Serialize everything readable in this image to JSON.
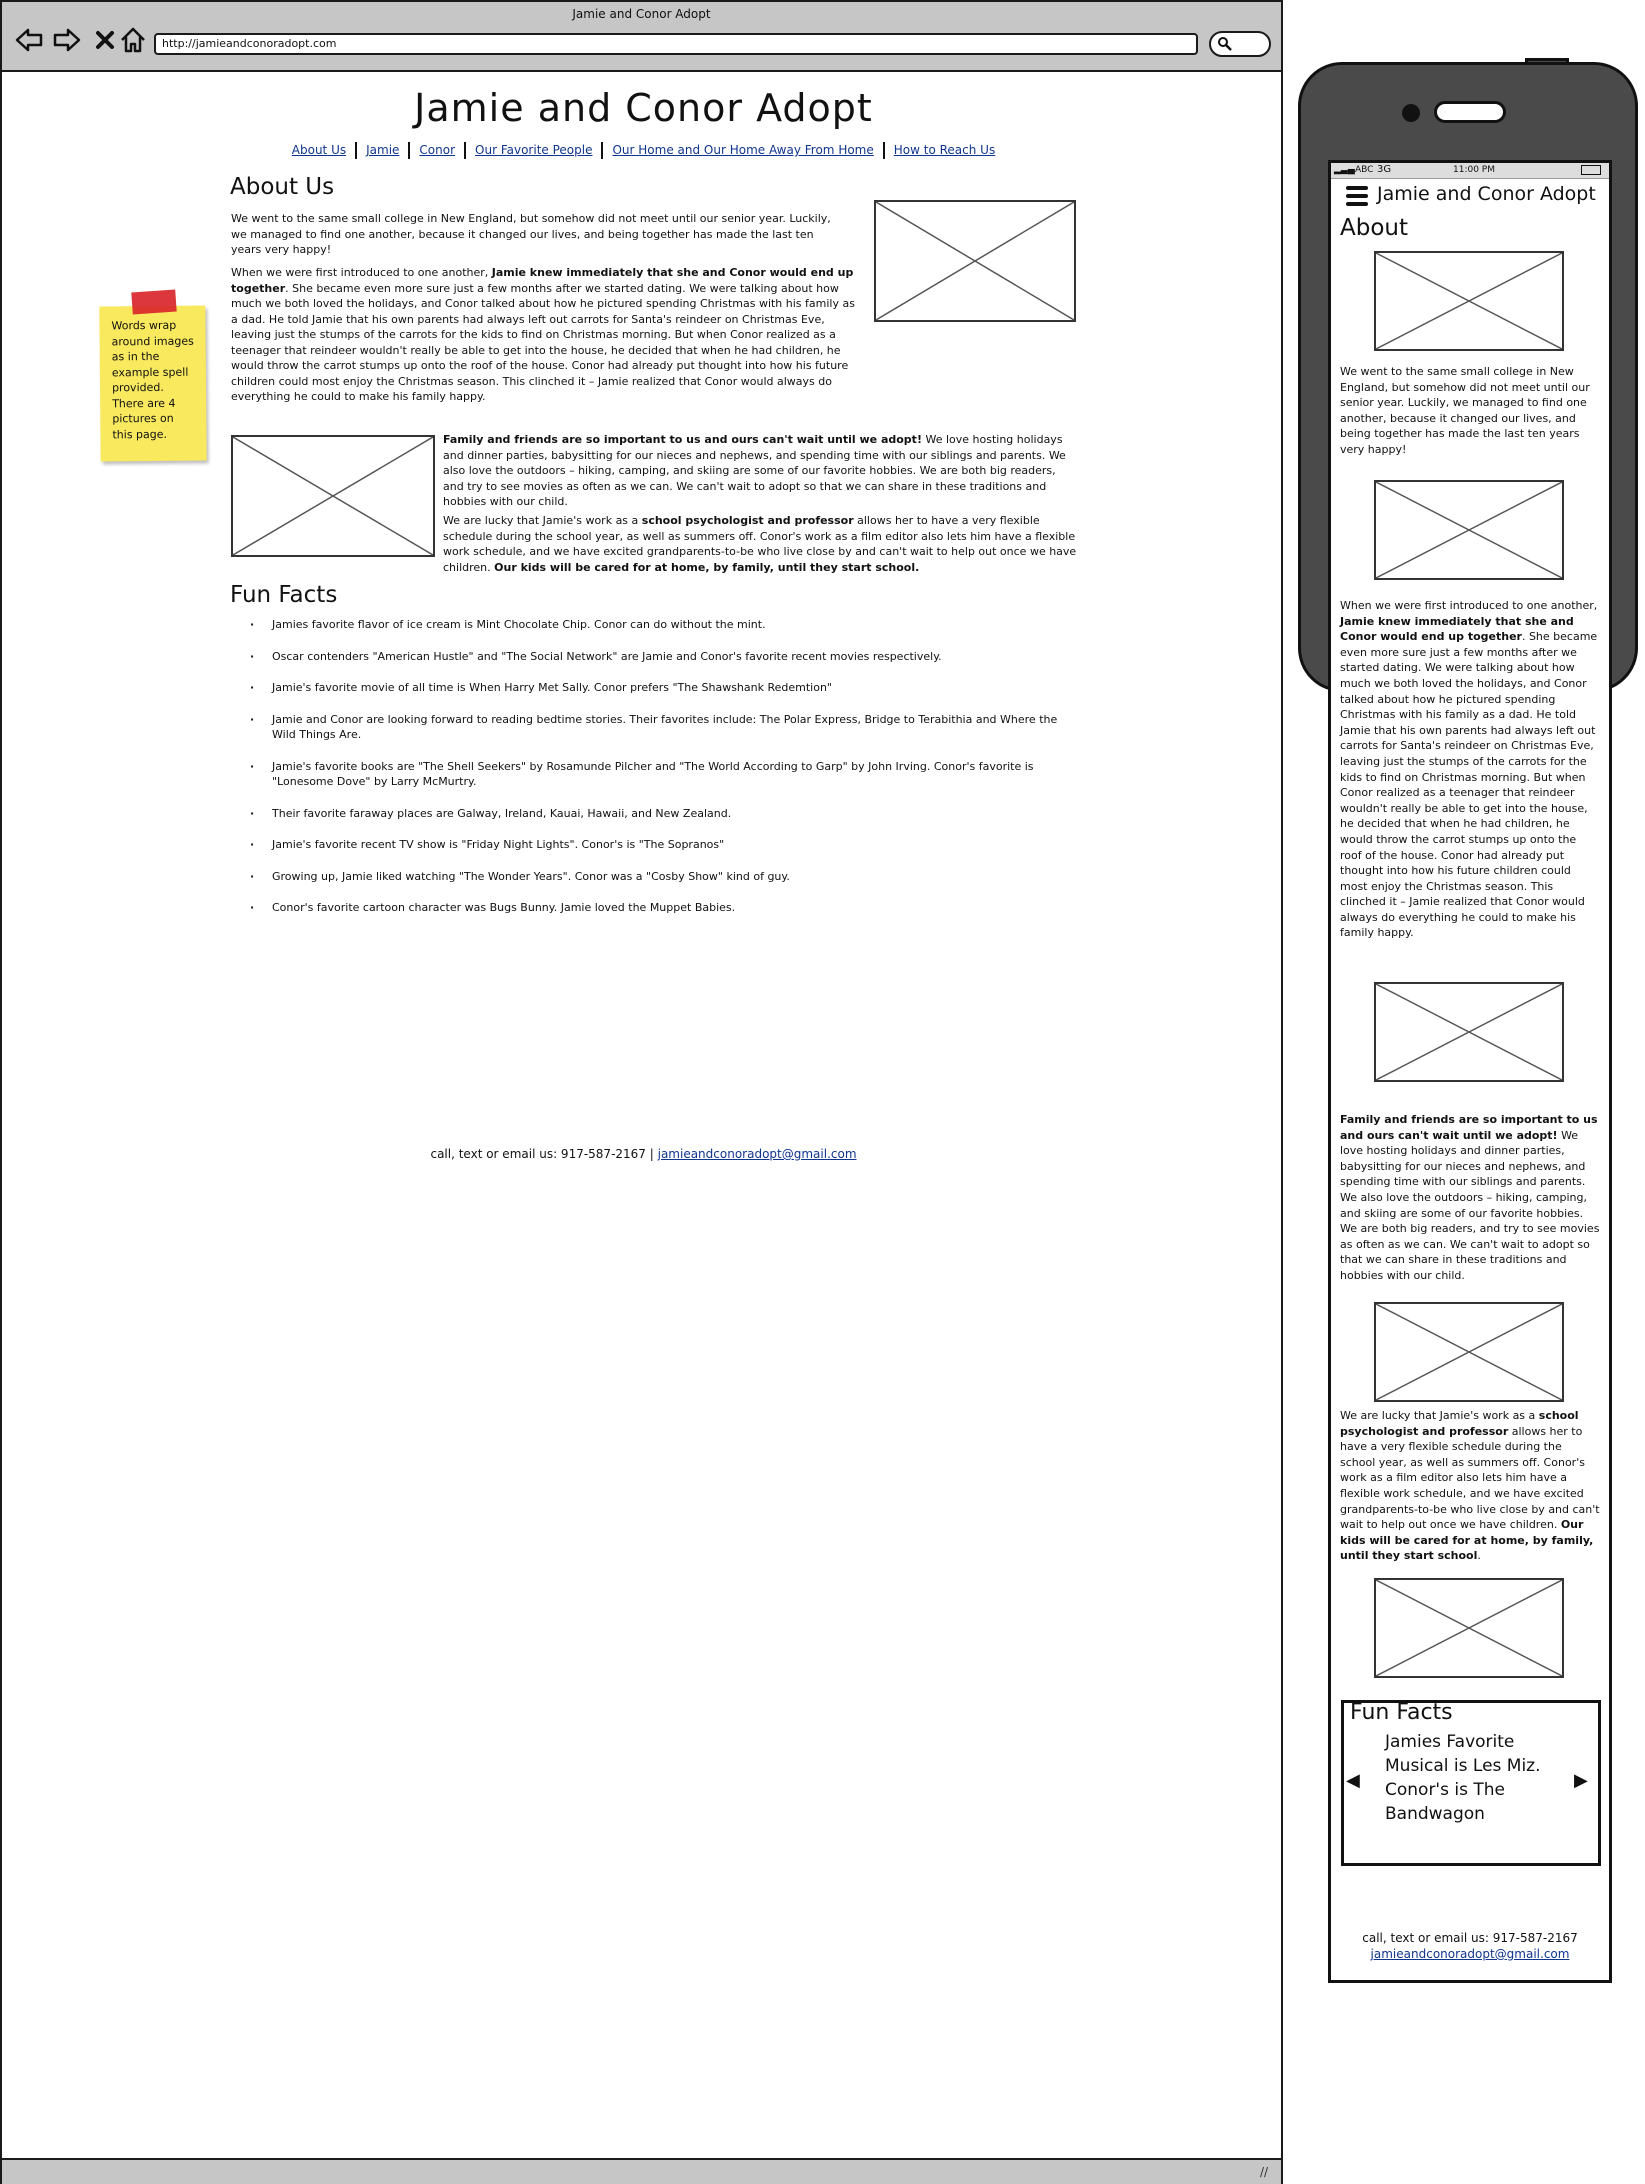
{
  "browser": {
    "window_title": "Jamie and Conor Adopt",
    "url": "http://jamieandconoradopt.com"
  },
  "desktop": {
    "site_title": "Jamie and Conor Adopt",
    "nav": [
      "About Us",
      "Jamie",
      "Conor",
      "Our Favorite People",
      "Our Home and Our Home Away From Home",
      "How to Reach Us"
    ],
    "about_heading": "About Us",
    "about_p1": "We went to the same small college in New England, but somehow did not meet until our senior year. Luckily, we managed to find one another, because it changed our lives, and being together has made the last ten years very happy!",
    "about_p2_pre": "When we were first introduced to one another, ",
    "about_p2_bold": "Jamie knew immediately that she and Conor would end up together",
    "about_p2_post": ". She became even more sure just a few months after we started dating. We were talking about how much we both loved the holidays, and Conor talked about how he pictured spending Christmas with his family as a dad. He told Jamie that his own parents had always left out carrots for Santa's reindeer on Christmas Eve, leaving just the stumps of the carrots for the kids to find on Christmas morning. But when Conor realized as a teenager that reindeer wouldn't really be able to get into the house, he decided that when he had children, he would throw the carrot stumps up onto the roof of the house. Conor had already put thought into how his future children could most enjoy the Christmas season. This clinched it – Jamie realized that Conor would always do everything he could to make his family happy.",
    "family_bold": "Family and friends are so important to us and ours can't wait until we adopt!",
    "family_post": " We love hosting holidays and dinner parties, babysitting for our nieces and nephews, and spending time with our siblings and parents. We also love the outdoors – hiking, camping, and skiing are some of our favorite hobbies. We are both big readers, and try to see movies as often as we can. We can't wait to adopt so that we can share in these traditions and hobbies with our child.",
    "work_pre": "We are lucky that Jamie's work as a ",
    "work_bold1": "school psychologist and professor",
    "work_mid": " allows her to have a very flexible schedule during the school year, as well as summers off. Conor's work as a film editor also lets him have a flexible work schedule, and we have excited grandparents-to-be who live close by and can't wait to help out once we have children. ",
    "work_bold2": "Our kids will be cared for at home, by family, until they start school.",
    "fun_heading": "Fun Facts",
    "fun_facts": [
      "Jamies favorite flavor of ice cream is Mint Chocolate Chip. Conor can do without the mint.",
      "Oscar contenders \"American Hustle\" and \"The Social Network\" are Jamie and Conor's favorite recent movies respectively.",
      "Jamie's favorite movie of all time is When Harry Met Sally. Conor prefers \"The Shawshank Redemtion\"",
      "Jamie and Conor are looking forward to reading bedtime stories. Their favorites include: The Polar Express, Bridge to Terabithia and Where the Wild Things Are.",
      "Jamie's favorite books are \"The Shell Seekers\" by Rosamunde Pilcher and \"The World According to Garp\" by John Irving. Conor's favorite is \"Lonesome Dove\" by Larry McMurtry.",
      "Their favorite faraway places are Galway, Ireland, Kauai, Hawaii, and New Zealand.",
      "Jamie's favorite recent TV show is \"Friday Night Lights\". Conor's is \"The Sopranos\"",
      "Growing up, Jamie liked watching \"The Wonder Years\". Conor was a \"Cosby Show\" kind of guy.",
      "Conor's favorite cartoon character was Bugs Bunny. Jamie loved the Muppet Babies."
    ],
    "footer_text": "call, text or email us: 917-587-2167 | ",
    "footer_email": "jamieandconoradopt@gmail.com"
  },
  "sticky_note": "Words wrap around images as in the example spell provided. There are 4 pictures on this page.",
  "mobile": {
    "carrier": "ABC",
    "network": "3G",
    "time": "11:00 PM",
    "title": "Jamie and Conor Adopt",
    "heading": "About",
    "p1": "We went to the same small college in New England, but somehow did not meet until our senior year. Luckily, we managed to find one another, because it changed our lives, and being together has made the last ten years very happy!",
    "p2_pre": "When we were first introduced to one another, ",
    "p2_bold": "Jamie knew immediately that she and Conor would end up together",
    "p2_post": ". She became even more sure just a few months after we started dating. We were talking about how much we both loved the holidays, and Conor talked about how he pictured spending Christmas with his family as a dad. He told Jamie that his own parents had always left out carrots for Santa's reindeer on Christmas Eve, leaving just the stumps of the carrots for the kids to find on Christmas morning. But when Conor realized as a teenager that reindeer wouldn't really be able to get into the house, he decided that when he had children, he would throw the carrot stumps up onto the roof of the house. Conor had already put thought into how his future children could most enjoy the Christmas season. This clinched it – Jamie realized that Conor would always do everything he could to make his family happy.",
    "p3_bold": "Family and friends are so important to us and ours can't wait until we adopt!",
    "p3_post": " We love hosting holidays and dinner parties, babysitting for our nieces and nephews, and spending time with our siblings and parents. We also love the outdoors – hiking, camping, and skiing are some of our favorite hobbies. We are both big readers, and try to see movies as often as we can. We can't wait to adopt so that we can share in these traditions and hobbies with our child.",
    "p4_pre": "We are lucky that Jamie's work as a ",
    "p4_bold1": "school psychologist and professor",
    "p4_mid": " allows her to have a very flexible schedule during the school year, as well as summers off. Conor's work as a film editor also lets him have a flexible work schedule, and we have excited grandparents-to-be who live close by and can't wait to help out once we have children. ",
    "p4_bold2": "Our kids will be cared for at home, by family, until they start school",
    "p4_end": ".",
    "fun_heading": "Fun Facts",
    "fun_fact": "Jamies Favorite Musical is Les Miz. Conor's is The Bandwagon",
    "footer_text": "call, text or email us: 917-587-2167",
    "footer_email": "jamieandconoradopt@gmail.com"
  },
  "icons": {
    "back": "back-arrow-icon",
    "forward": "forward-arrow-icon",
    "stop": "close-icon",
    "home": "home-icon",
    "search": "search-icon",
    "menu": "hamburger-menu-icon",
    "image": "image-placeholder-icon",
    "carousel_prev": "triangle-left-icon",
    "carousel_next": "triangle-right-icon"
  },
  "colors": {
    "chrome": "#c6c6c6",
    "link": "#10358f",
    "sticky": "#f8e95e",
    "tape": "#d9262b",
    "phone_body": "#4a4a4a"
  }
}
